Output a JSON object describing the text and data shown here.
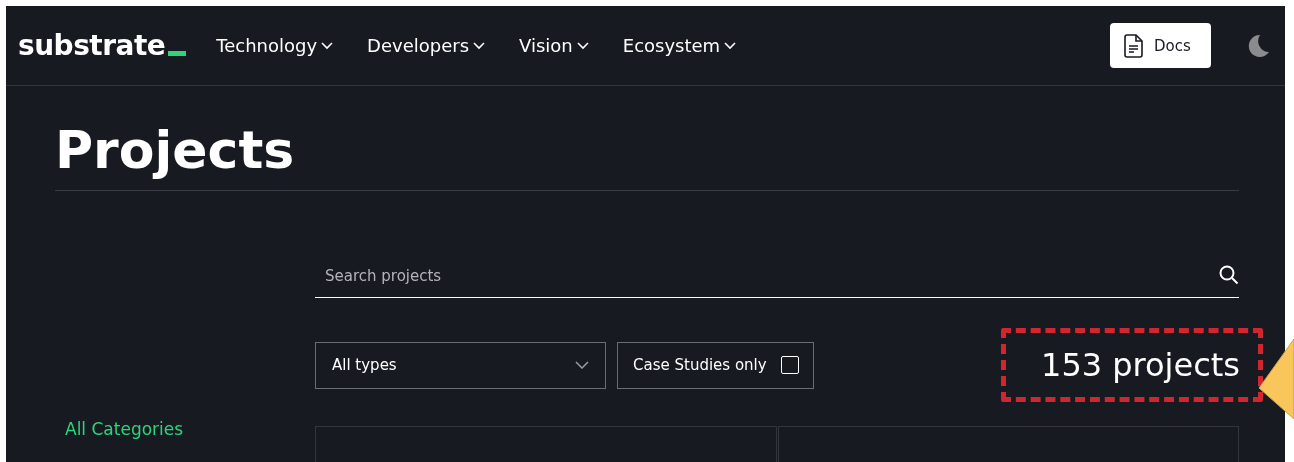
{
  "nav": {
    "logo": "substrate",
    "items": [
      {
        "label": "Technology",
        "has_menu": true
      },
      {
        "label": "Developers",
        "has_menu": true
      },
      {
        "label": "Vision",
        "has_menu": true
      },
      {
        "label": "Ecosystem",
        "has_menu": true
      }
    ],
    "docs_button": "Docs"
  },
  "page": {
    "title": "Projects"
  },
  "search": {
    "placeholder": "Search projects"
  },
  "filters": {
    "type_select": "All types",
    "case_studies": {
      "label": "Case Studies only",
      "checked": false
    }
  },
  "count": "153 projects",
  "sidebar": {
    "items": [
      {
        "label": "All Categories",
        "selected": true
      }
    ]
  }
}
